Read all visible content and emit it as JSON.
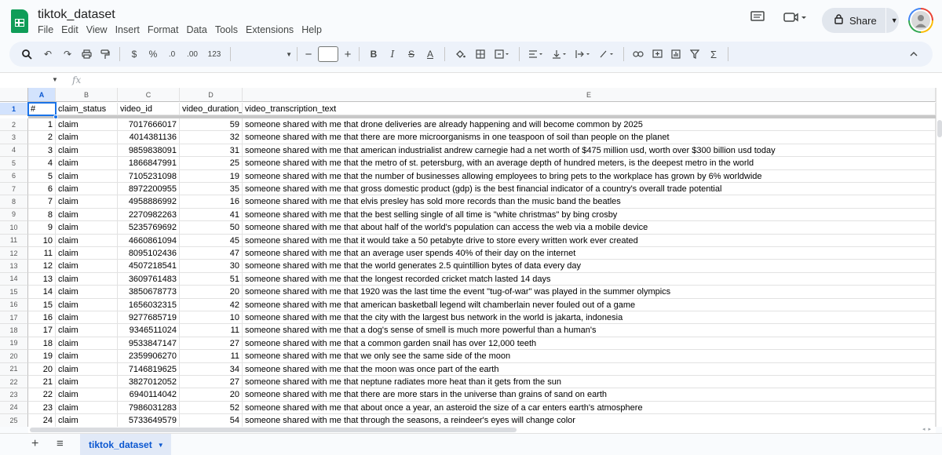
{
  "header": {
    "title": "tiktok_dataset",
    "menu": [
      "File",
      "Edit",
      "View",
      "Insert",
      "Format",
      "Data",
      "Tools",
      "Extensions",
      "Help"
    ],
    "share_label": "Share",
    "avatar_initial": ""
  },
  "toolbar": {
    "search_icon": "search-icon",
    "currency": "$",
    "percent": "%",
    "dec_decrease": ".0",
    "dec_increase": ".00",
    "number_format": "123",
    "font_minus": "−",
    "font_plus": "+",
    "bold": "B",
    "italic": "I",
    "strike": "S",
    "text_color": "A",
    "function_sigma": "Σ"
  },
  "formula_bar": {
    "fx": "fx",
    "value": ""
  },
  "grid": {
    "columns": [
      {
        "letter": "A"
      },
      {
        "letter": "B"
      },
      {
        "letter": "C"
      },
      {
        "letter": "D"
      },
      {
        "letter": "E"
      }
    ],
    "header_row": {
      "num": "1",
      "cells": [
        "#",
        "claim_status",
        "video_id",
        "video_duration_sec",
        "video_transcription_text"
      ]
    },
    "rows": [
      {
        "num": "2",
        "cells": [
          "1",
          "claim",
          "7017666017",
          "59",
          "someone shared with me that drone deliveries are already happening and will become common by 2025"
        ]
      },
      {
        "num": "3",
        "cells": [
          "2",
          "claim",
          "4014381136",
          "32",
          "someone shared with me that there are more microorganisms in one teaspoon of soil than people on the planet"
        ]
      },
      {
        "num": "4",
        "cells": [
          "3",
          "claim",
          "9859838091",
          "31",
          "someone shared with me that american industrialist andrew carnegie had a net worth of $475 million usd, worth over $300 billion usd today"
        ]
      },
      {
        "num": "5",
        "cells": [
          "4",
          "claim",
          "1866847991",
          "25",
          "someone shared with me that the metro of st. petersburg, with an average depth of hundred meters, is the deepest metro in the world"
        ]
      },
      {
        "num": "6",
        "cells": [
          "5",
          "claim",
          "7105231098",
          "19",
          "someone shared with me that the number of businesses allowing employees to bring pets to the workplace has grown by 6% worldwide"
        ]
      },
      {
        "num": "7",
        "cells": [
          "6",
          "claim",
          "8972200955",
          "35",
          "someone shared with me that gross domestic product (gdp) is the best financial indicator of a country's overall trade potential"
        ]
      },
      {
        "num": "8",
        "cells": [
          "7",
          "claim",
          "4958886992",
          "16",
          "someone shared with me that elvis presley has sold more records than the music band the beatles"
        ]
      },
      {
        "num": "9",
        "cells": [
          "8",
          "claim",
          "2270982263",
          "41",
          "someone shared with me that the best selling single of all time is \"white christmas\" by bing crosby"
        ]
      },
      {
        "num": "10",
        "cells": [
          "9",
          "claim",
          "5235769692",
          "50",
          "someone shared with me that about half of the world's population can access the web via a mobile device"
        ]
      },
      {
        "num": "11",
        "cells": [
          "10",
          "claim",
          "4660861094",
          "45",
          "someone shared with me that it would take a 50 petabyte drive to store every written work ever created"
        ]
      },
      {
        "num": "12",
        "cells": [
          "11",
          "claim",
          "8095102436",
          "47",
          "someone shared with me that an average user spends 40% of their day on the internet"
        ]
      },
      {
        "num": "13",
        "cells": [
          "12",
          "claim",
          "4507218541",
          "30",
          "someone shared with me that the world generates 2.5 quintillion bytes of data every day"
        ]
      },
      {
        "num": "14",
        "cells": [
          "13",
          "claim",
          "3609761483",
          "51",
          "someone shared with me that the longest recorded cricket match lasted 14 days"
        ]
      },
      {
        "num": "15",
        "cells": [
          "14",
          "claim",
          "3850678773",
          "20",
          "someone shared with me that 1920 was the last time the event \"tug-of-war\" was played in the summer olympics"
        ]
      },
      {
        "num": "16",
        "cells": [
          "15",
          "claim",
          "1656032315",
          "42",
          "someone shared with me that american basketball legend wilt chamberlain never fouled out of a game"
        ]
      },
      {
        "num": "17",
        "cells": [
          "16",
          "claim",
          "9277685719",
          "10",
          "someone shared with me that the city with the largest bus network in the world is jakarta, indonesia"
        ]
      },
      {
        "num": "18",
        "cells": [
          "17",
          "claim",
          "9346511024",
          "11",
          "someone shared with me that a dog's sense of smell is much more powerful than a human's"
        ]
      },
      {
        "num": "19",
        "cells": [
          "18",
          "claim",
          "9533847147",
          "27",
          "someone shared with me that a common garden snail has over 12,000 teeth"
        ]
      },
      {
        "num": "20",
        "cells": [
          "19",
          "claim",
          "2359906270",
          "11",
          "someone shared with me that we only see the same side of the moon"
        ]
      },
      {
        "num": "21",
        "cells": [
          "20",
          "claim",
          "7146819625",
          "34",
          "someone shared with me that the moon was once part of the earth"
        ]
      },
      {
        "num": "22",
        "cells": [
          "21",
          "claim",
          "3827012052",
          "27",
          "someone shared with me that neptune radiates more heat than it gets from the sun"
        ]
      },
      {
        "num": "23",
        "cells": [
          "22",
          "claim",
          "6940114042",
          "20",
          "someone shared with me that there are more stars in the universe than grains of sand on earth"
        ]
      },
      {
        "num": "24",
        "cells": [
          "23",
          "claim",
          "7986031283",
          "52",
          "someone shared with me that about once a year, an asteroid the size of a car enters earth's atmosphere"
        ]
      },
      {
        "num": "25",
        "cells": [
          "24",
          "claim",
          "5733649579",
          "54",
          "someone shared with me that through the seasons, a reindeer's eyes will change color"
        ]
      }
    ]
  },
  "bottom": {
    "add_sheet": "+",
    "all_sheets": "≡",
    "sheet_tab": "tiktok_dataset"
  },
  "colors": {
    "sheets_green": "#0f9d58",
    "selection_blue": "#1a73e8",
    "active_header": "#d3e3fd"
  }
}
